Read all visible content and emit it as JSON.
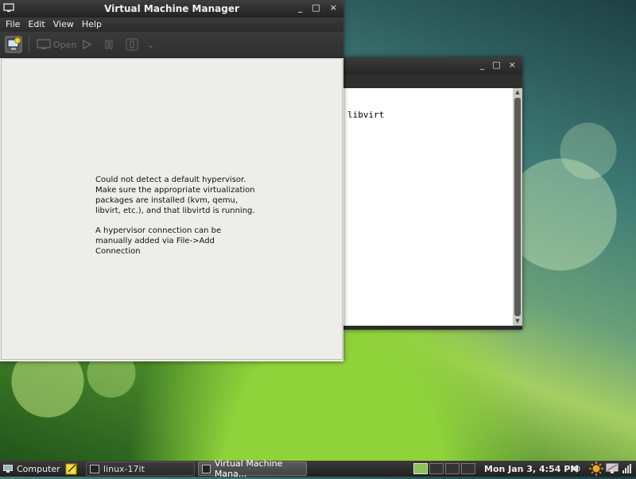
{
  "terminal": {
    "line": "libvirt",
    "buttons": {
      "minimize": "_",
      "maximize": "□",
      "close": "×"
    }
  },
  "vmm": {
    "title": "Virtual Machine Manager",
    "buttons": {
      "minimize": "_",
      "maximize": "□",
      "close": "×"
    },
    "menu": [
      "File",
      "Edit",
      "View",
      "Help"
    ],
    "toolbar": {
      "open_label": "Open",
      "dropdown": "⌄"
    },
    "message_1": "Could not detect a default hypervisor. Make sure the appropriate virtualization packages are installed (kvm, qemu, libvirt, etc.), and that libvirtd is running.",
    "message_2": "A hypervisor connection can be manually added via File->Add Connection"
  },
  "panel": {
    "computer_label": "Computer",
    "task_terminal": "linux-17it",
    "task_vmm": "Virtual Machine Mana...",
    "clock": "Mon Jan  3,  4:54 PM",
    "colors": {
      "accent": "#8fd23a",
      "panel": "#2a2a2a"
    }
  }
}
